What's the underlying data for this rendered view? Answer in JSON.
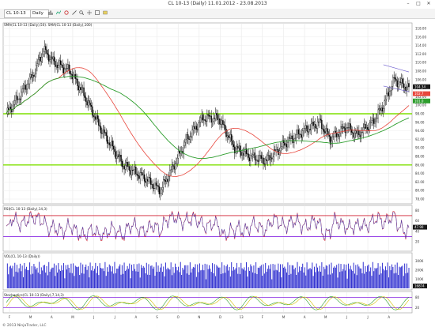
{
  "window": {
    "title": "CL 10-13 (Daily)  11.01.2012 - 23.08.2013",
    "minimize_glyph": "–",
    "maximize_glyph": "□",
    "close_glyph": "✕"
  },
  "toolbar": {
    "instrument": "CL 10-13",
    "interval": "Daily"
  },
  "price_panel": {
    "label": "SMA(CL 10-13 (Daily),50). SMA(CL 10-13 (Daily),100)",
    "y_ticks": [
      "118.00",
      "116.00",
      "114.00",
      "112.00",
      "110.00",
      "108.00",
      "106.00",
      "104.00",
      "102.00",
      "100.00",
      "98.00",
      "96.00",
      "94.00",
      "92.00",
      "90.00",
      "88.00",
      "86.00",
      "84.00",
      "82.00",
      "80.00",
      "78.00"
    ],
    "last_price": "104.34",
    "sma50_value": "102.7",
    "sma100_value": "101.0",
    "horizontal_levels": [
      98.0,
      86.0
    ],
    "level_color": "#7fe000"
  },
  "rsi_panel": {
    "label": "RSI(CL 10-13 (Daily),14,3)",
    "y_ticks": [
      "80",
      "60",
      "40",
      "20"
    ],
    "value": "47.90",
    "upper_line": 70,
    "lower_line": 30
  },
  "volume_panel": {
    "label": "VOL(CL 10-13 (Daily))",
    "y_ticks": [
      "300K",
      "200K",
      "100K"
    ],
    "value": "16874"
  },
  "stoch_panel": {
    "label": "Stochastics(CL 10-13 (Daily),7,14,3)",
    "y_ticks": [
      "80",
      "20"
    ]
  },
  "x_axis": {
    "labels": [
      "F",
      "M",
      "A",
      "M",
      "J",
      "J",
      "A",
      "S",
      "O",
      "N",
      "D",
      "13",
      "F",
      "M",
      "A",
      "M",
      "J",
      "J",
      "A"
    ]
  },
  "footer": {
    "copyright": "© 2013 NinjaTrader, LLC"
  },
  "colors": {
    "candle_up": "#ffffff",
    "candle_down": "#000000",
    "sma_fast": "#e8463c",
    "sma_slow": "#2e9e2e",
    "rsi_line": "#d02030",
    "rsi_band": "#8a2be2",
    "volume_bars": "#3030d0",
    "stoch_k": "#2e9e2e",
    "stoch_d": "#d4c000",
    "trend_line": "#6a5acd"
  }
}
